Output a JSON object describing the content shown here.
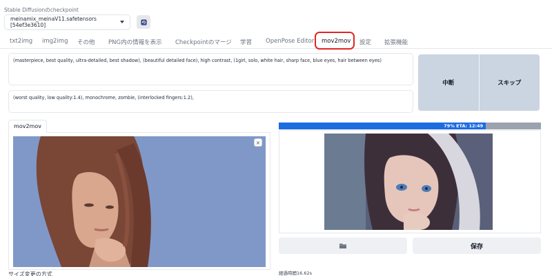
{
  "checkpoint": {
    "label": "Stable Diffusionのcheckpoint",
    "value": "meinamix_meinaV11.safetensors [54ef3e3610]"
  },
  "tabs": [
    {
      "label": "txt2img",
      "active": false
    },
    {
      "label": "img2img",
      "active": false
    },
    {
      "label": "その他",
      "active": false
    },
    {
      "label": "PNG内の情報を表示",
      "active": false
    },
    {
      "label": "Checkpointのマージ",
      "active": false
    },
    {
      "label": "学習",
      "active": false
    },
    {
      "label": "OpenPose Editor",
      "active": false
    },
    {
      "label": "mov2mov",
      "active": true
    },
    {
      "label": "設定",
      "active": false
    },
    {
      "label": "拡張機能",
      "active": false
    }
  ],
  "prompts": {
    "positive": "(masterpiece, best quality, ultra-detailed, best shadow), (beautiful detailed face), high contrast, (1girl, solo, white hair, sharp face, blue eyes, hair between eyes)",
    "negative": "(worst quality, low quality:1.4), monochrome, zombie, (interlocked fingers:1.2),"
  },
  "actions": {
    "interrupt": "中断",
    "skip": "スキップ"
  },
  "input": {
    "tab_label": "mov2mov",
    "close_symbol": "×",
    "resize_label": "サイズ変更の方式"
  },
  "progress": {
    "percent": 79,
    "text": "79% ETA: 12:49"
  },
  "output": {
    "folder_icon": "folder-icon",
    "save_label": "保存",
    "elapsed": "経過時間16.62s"
  },
  "colors": {
    "accent_blue": "#1d6ce0",
    "highlight_red": "#e02424",
    "button_gray": "#cbd5e1"
  }
}
